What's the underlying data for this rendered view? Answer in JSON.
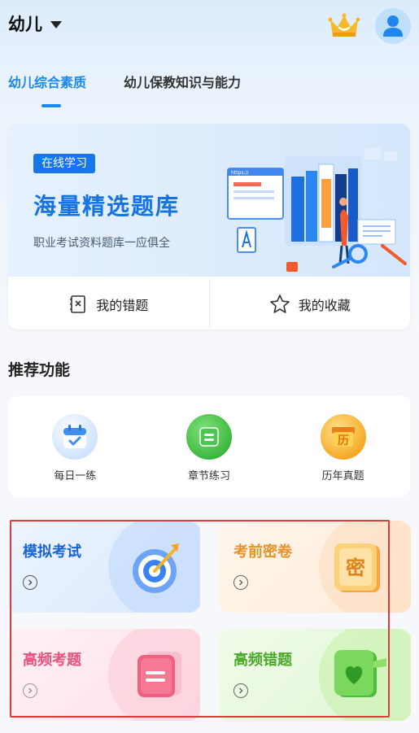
{
  "header": {
    "grade_label": "幼儿",
    "icons": {
      "vip": "crown-icon",
      "profile": "user-avatar-icon"
    }
  },
  "tabs": [
    {
      "label": "幼儿综合素质",
      "active": true
    },
    {
      "label": "幼儿保教知识与能力",
      "active": false
    }
  ],
  "banner": {
    "badge": "在线学习",
    "title": "海量精选题库",
    "subtitle": "职业考试资料题库一应俱全",
    "illustration": "study-library-illustration",
    "url_text": "https://"
  },
  "banner_actions": [
    {
      "label": "我的错题",
      "icon": "wrong-questions-icon"
    },
    {
      "label": "我的收藏",
      "icon": "star-icon"
    }
  ],
  "recommend": {
    "title": "推荐功能",
    "features": [
      {
        "label": "每日一练",
        "icon": "calendar-check-icon",
        "color": "#3f8ef0"
      },
      {
        "label": "章节练习",
        "icon": "chapter-list-icon",
        "color": "#4cc552"
      },
      {
        "label": "历年真题",
        "icon": "past-papers-icon",
        "color": "#f5a623",
        "glyph": "历"
      }
    ]
  },
  "grid": [
    {
      "label": "模拟考试",
      "color": "#1a64d6",
      "icon": "target-dart-icon"
    },
    {
      "label": "考前密卷",
      "color": "#e8922a",
      "icon": "secret-paper-icon",
      "glyph": "密"
    },
    {
      "label": "高频考题",
      "color": "#e8527e",
      "icon": "document-lines-icon"
    },
    {
      "label": "高频错题",
      "color": "#4aa929",
      "icon": "heart-book-icon"
    }
  ],
  "colors": {
    "accent": "#1b88f0",
    "highlight": "#e03a3a"
  }
}
